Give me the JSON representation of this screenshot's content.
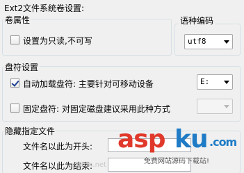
{
  "dialog": {
    "title": "Ext2文件系统卷设置:"
  },
  "volume_attributes": {
    "group_title": "卷属性",
    "readonly_label": "设置为只读,不可写",
    "readonly_checked": false,
    "codepage": {
      "label": "语种编码",
      "value": "utf8"
    }
  },
  "drive_letter": {
    "group_title": "盘符设置",
    "auto_mount_label": "自动加载盘符: 主要针对可移动设备",
    "auto_mount_checked": true,
    "auto_mount_value": "E:",
    "fixed_label": "固定盘符: 对固定磁盘建议采用此种方式",
    "fixed_checked": false,
    "fixed_value": ""
  },
  "hidden_files": {
    "group_title": "隐藏指定文件",
    "prefix_label": "文件名以此为开头:",
    "prefix_value": "",
    "suffix_label": "文件名以此为结束:",
    "suffix_value": ""
  },
  "watermark": {
    "brand_red": "asp",
    "brand_blue": "ku",
    "brand_suffix": ".com",
    "subtitle": "免费网站源码下载站!",
    "faint_url": "csdn.net",
    "colors": {
      "red": "#e0392b",
      "blue": "#1f7bc6"
    }
  }
}
